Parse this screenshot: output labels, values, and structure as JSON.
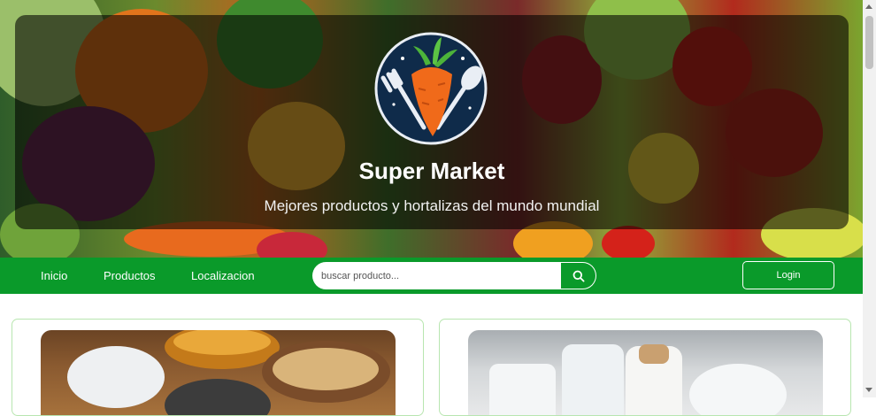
{
  "brand": {
    "title": "Super Market",
    "subtitle": "Mejores productos y hortalizas del mundo mundial",
    "logo_icon": "carrot-fork-spoon-logo"
  },
  "nav": {
    "links": [
      "Inicio",
      "Productos",
      "Localizacion"
    ],
    "search_placeholder": "buscar producto...",
    "search_icon": "search-icon",
    "login_label": "Login"
  },
  "colors": {
    "nav_green": "#0a9a2a",
    "card_border": "#b8e6b0"
  },
  "products": [
    {
      "image": "grains-and-milk-photo"
    },
    {
      "image": "milk-jars-photo"
    }
  ]
}
